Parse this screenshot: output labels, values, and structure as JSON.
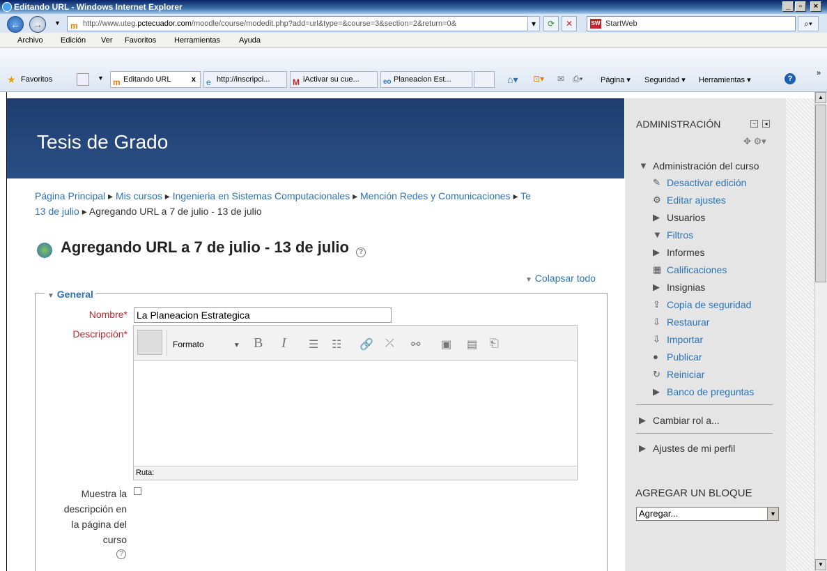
{
  "window": {
    "title": "Editando URL - Windows Internet Explorer"
  },
  "address": {
    "url_prefix": "http://www.uteg.",
    "url_domain": "pctecuador.com",
    "url_rest": "/moodle/course/modedit.php?add=url&type=&course=3&section=2&return=0&",
    "search_placeholder": "StartWeb"
  },
  "menu": [
    "Archivo",
    "Edición",
    "Ver",
    "Favoritos",
    "Herramientas",
    "Ayuda"
  ],
  "favorites": {
    "label": "Favoritos",
    "tabs": [
      "Editando URL",
      "http://inscripci...",
      "iActivar su cue...",
      "Planeacion Est..."
    ],
    "commands": [
      "Página",
      "Seguridad",
      "Herramientas"
    ]
  },
  "site": {
    "title": "Tesis de Grado"
  },
  "breadcrumb": {
    "items": [
      "Página Principal",
      "Mis cursos",
      "Ingenieria en Sistemas Computacionales",
      "Mención Redes y Comunicaciones",
      "Te"
    ],
    "line2_link": "13 de julio",
    "line2_text": "Agregando URL a 7 de julio - 13 de julio"
  },
  "page": {
    "heading": "Agregando URL a 7 de julio - 13 de julio",
    "collapse_all": "Colapsar todo"
  },
  "form": {
    "legend": "General",
    "name_label": "Nombre",
    "name_value": "La Planeacion Estrategica",
    "desc_label": "Descripción",
    "format_label": "Formato",
    "path_label": "Ruta:",
    "show_desc_label": [
      "Muestra la",
      "descripción en",
      "la página del",
      "curso"
    ]
  },
  "admin": {
    "title": "ADMINISTRACIÓN",
    "course_admin": "Administración del curso",
    "items": [
      {
        "label": "Desactivar edición",
        "icon": "pencil-icon",
        "link": true
      },
      {
        "label": "Editar ajustes",
        "icon": "gear-icon",
        "link": true
      },
      {
        "label": "Usuarios",
        "icon": "triangle-right-icon",
        "link": false
      },
      {
        "label": "Filtros",
        "icon": "filter-icon",
        "link": true
      },
      {
        "label": "Informes",
        "icon": "triangle-right-icon",
        "link": false
      },
      {
        "label": "Calificaciones",
        "icon": "grid-icon",
        "link": true
      },
      {
        "label": "Insignias",
        "icon": "triangle-right-icon",
        "link": false
      },
      {
        "label": "Copia de seguridad",
        "icon": "upload-icon",
        "link": true
      },
      {
        "label": "Restaurar",
        "icon": "download-icon",
        "link": true
      },
      {
        "label": "Importar",
        "icon": "download-icon",
        "link": true
      },
      {
        "label": "Publicar",
        "icon": "publish-icon",
        "link": true
      },
      {
        "label": "Reiniciar",
        "icon": "refresh-icon",
        "link": true
      },
      {
        "label": "Banco de preguntas",
        "icon": "triangle-right-icon",
        "link": true
      }
    ],
    "switch_role": "Cambiar rol a...",
    "profile_settings": "Ajustes de mi perfil"
  },
  "add_block": {
    "title": "AGREGAR UN BLOQUE",
    "select_value": "Agregar..."
  },
  "colors": {
    "link": "#2a73b8",
    "required": "#c0252c",
    "banner": "#1f3d6e",
    "sidebar": "#e5e5e5"
  }
}
